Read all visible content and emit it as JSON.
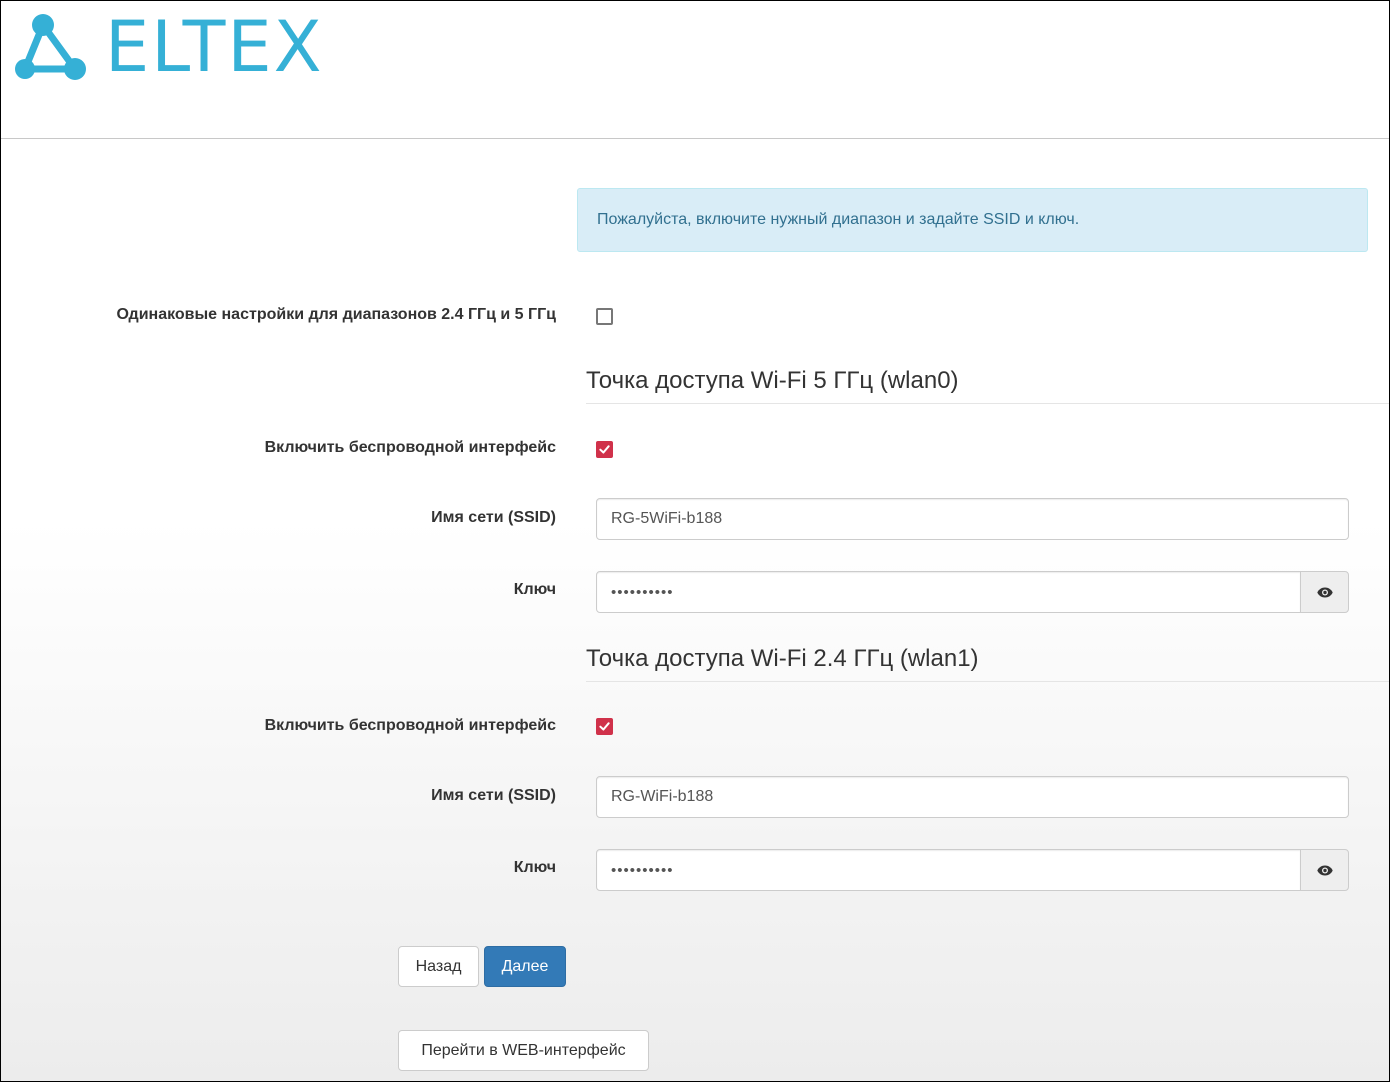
{
  "brand": {
    "logo_text": "ELTEX",
    "color": "#35b0d6"
  },
  "alert": {
    "text": "Пожалуйста, включите нужный диапазон и задайте SSID и ключ."
  },
  "same_settings": {
    "label": "Одинаковые настройки для диапазонов 2.4 ГГц и 5 ГГц",
    "checked": false
  },
  "wlan0": {
    "title": "Точка доступа Wi-Fi 5 ГГц (wlan0)",
    "enable_label": "Включить беспроводной интерфейс",
    "enabled": true,
    "ssid_label": "Имя сети (SSID)",
    "ssid_value": "RG-5WiFi-b188",
    "key_label": "Ключ",
    "key_value": "••••••••••"
  },
  "wlan1": {
    "title": "Точка доступа Wi-Fi 2.4 ГГц (wlan1)",
    "enable_label": "Включить беспроводной интерфейс",
    "enabled": true,
    "ssid_label": "Имя сети (SSID)",
    "ssid_value": "RG-WiFi-b188",
    "key_label": "Ключ",
    "key_value": "••••••••••"
  },
  "buttons": {
    "back": "Назад",
    "next": "Далее",
    "web": "Перейти в WEB-интерфейс"
  },
  "colors": {
    "primary": "#337ab7",
    "checkbox_checked": "#d0314a",
    "alert_bg": "#d9edf7",
    "alert_text": "#31708f"
  }
}
